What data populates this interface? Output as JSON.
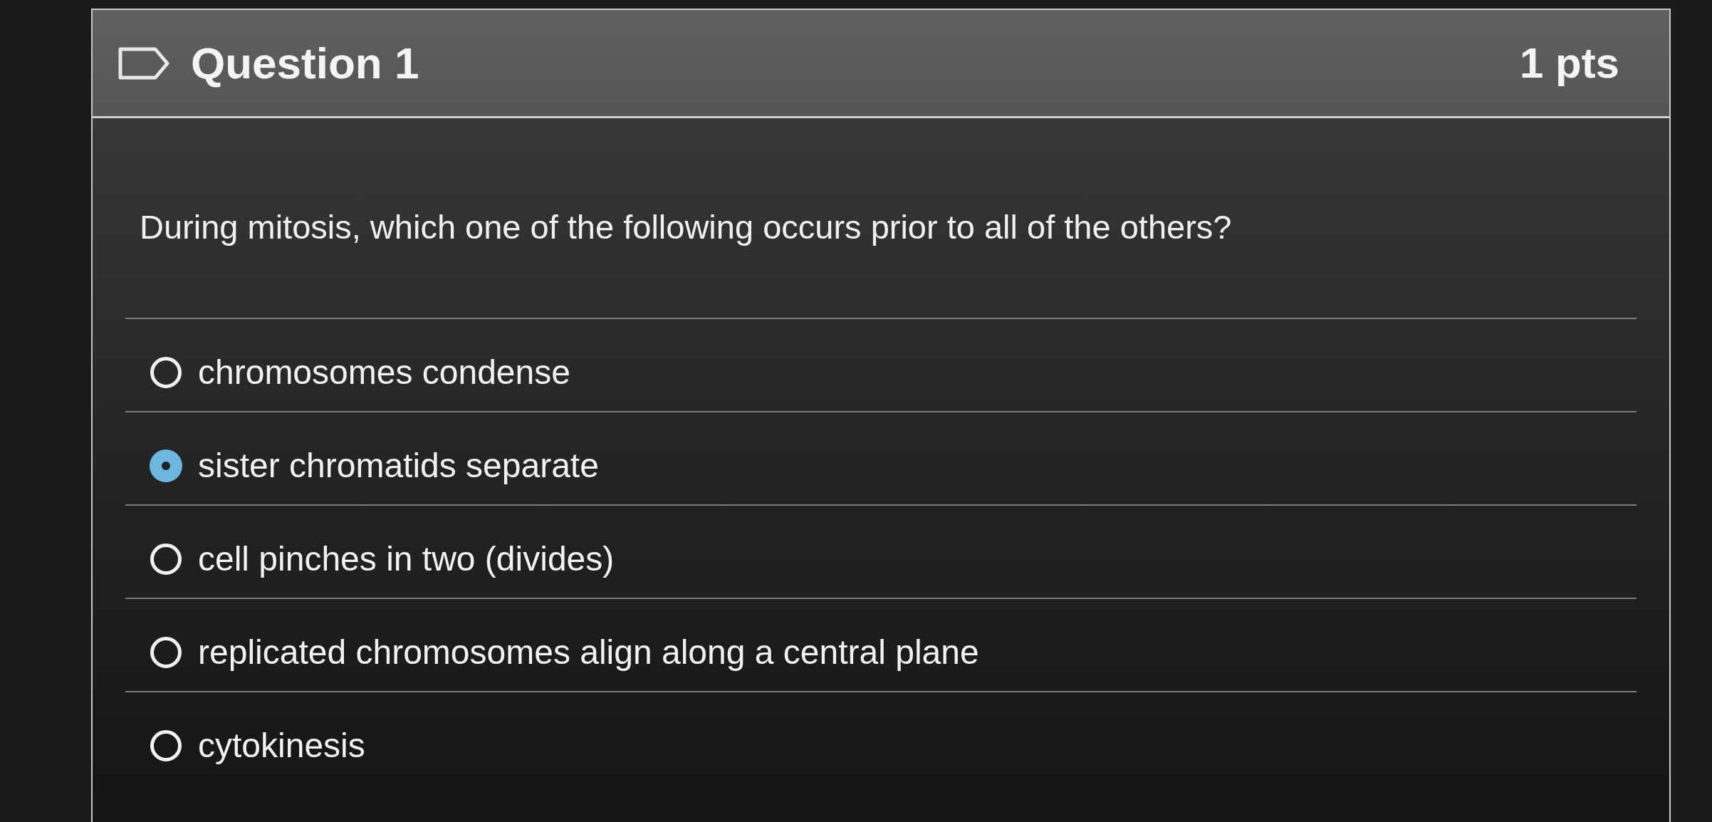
{
  "question": {
    "flagged": false,
    "title": "Question 1",
    "points": "1 pts",
    "prompt": "During mitosis, which one of the following occurs prior to all of the others?"
  },
  "answers": [
    {
      "label": "chromosomes condense",
      "selected": false
    },
    {
      "label": "sister chromatids separate",
      "selected": true
    },
    {
      "label": "cell pinches in two (divides)",
      "selected": false
    },
    {
      "label": "replicated chromosomes align along a central plane",
      "selected": false
    },
    {
      "label": "cytokinesis",
      "selected": false
    }
  ]
}
